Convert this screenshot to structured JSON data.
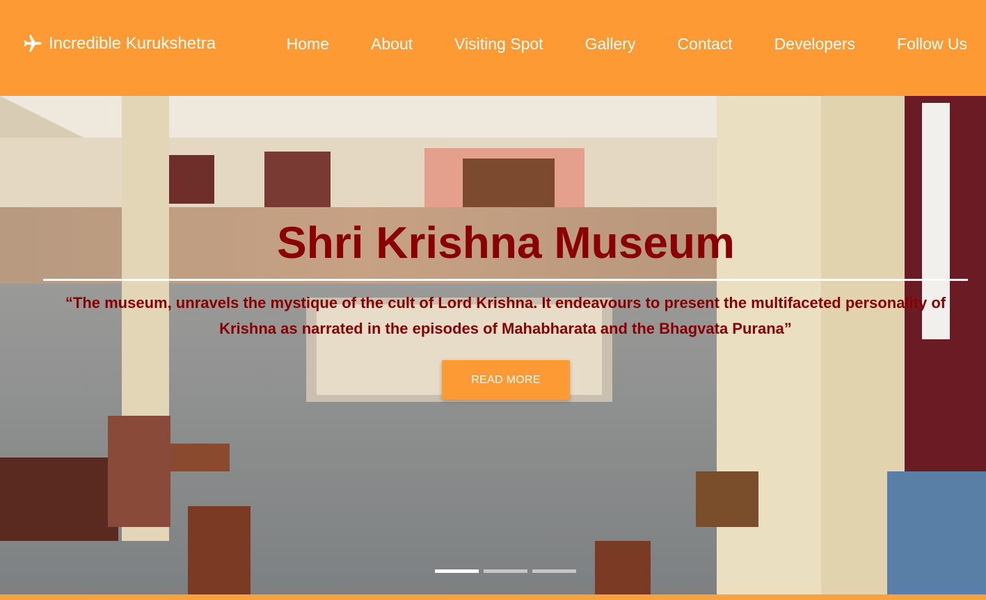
{
  "brand": {
    "name": "Incredible Kurukshetra",
    "icon": "airplane-icon"
  },
  "nav": {
    "items": [
      {
        "label": "Home"
      },
      {
        "label": "About"
      },
      {
        "label": "Visiting Spot"
      },
      {
        "label": "Gallery"
      },
      {
        "label": "Contact"
      },
      {
        "label": "Developers"
      },
      {
        "label": "Follow Us"
      }
    ]
  },
  "hero": {
    "title": "Shri Krishna Museum",
    "description": "“The museum, unravels the mystique of the cult of Lord Krishna. It endeavours to present the multifaceted personality of Krishna as narrated in the episodes of Mahabharata and the Bhagvata Purana”",
    "button_label": "READ MORE",
    "slides_total": 3,
    "active_slide": 1
  },
  "colors": {
    "navbar": "#fe9a33",
    "accent": "#fe9a33",
    "title_text": "#8a0000",
    "nav_text": "#ffffff"
  }
}
